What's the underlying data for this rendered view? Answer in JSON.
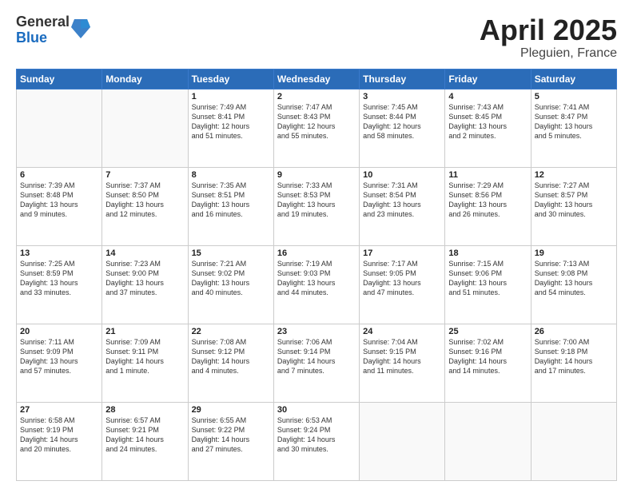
{
  "header": {
    "logo_general": "General",
    "logo_blue": "Blue",
    "month": "April 2025",
    "location": "Pleguien, France"
  },
  "weekdays": [
    "Sunday",
    "Monday",
    "Tuesday",
    "Wednesday",
    "Thursday",
    "Friday",
    "Saturday"
  ],
  "weeks": [
    [
      {
        "day": "",
        "info": ""
      },
      {
        "day": "",
        "info": ""
      },
      {
        "day": "1",
        "info": "Sunrise: 7:49 AM\nSunset: 8:41 PM\nDaylight: 12 hours\nand 51 minutes."
      },
      {
        "day": "2",
        "info": "Sunrise: 7:47 AM\nSunset: 8:43 PM\nDaylight: 12 hours\nand 55 minutes."
      },
      {
        "day": "3",
        "info": "Sunrise: 7:45 AM\nSunset: 8:44 PM\nDaylight: 12 hours\nand 58 minutes."
      },
      {
        "day": "4",
        "info": "Sunrise: 7:43 AM\nSunset: 8:45 PM\nDaylight: 13 hours\nand 2 minutes."
      },
      {
        "day": "5",
        "info": "Sunrise: 7:41 AM\nSunset: 8:47 PM\nDaylight: 13 hours\nand 5 minutes."
      }
    ],
    [
      {
        "day": "6",
        "info": "Sunrise: 7:39 AM\nSunset: 8:48 PM\nDaylight: 13 hours\nand 9 minutes."
      },
      {
        "day": "7",
        "info": "Sunrise: 7:37 AM\nSunset: 8:50 PM\nDaylight: 13 hours\nand 12 minutes."
      },
      {
        "day": "8",
        "info": "Sunrise: 7:35 AM\nSunset: 8:51 PM\nDaylight: 13 hours\nand 16 minutes."
      },
      {
        "day": "9",
        "info": "Sunrise: 7:33 AM\nSunset: 8:53 PM\nDaylight: 13 hours\nand 19 minutes."
      },
      {
        "day": "10",
        "info": "Sunrise: 7:31 AM\nSunset: 8:54 PM\nDaylight: 13 hours\nand 23 minutes."
      },
      {
        "day": "11",
        "info": "Sunrise: 7:29 AM\nSunset: 8:56 PM\nDaylight: 13 hours\nand 26 minutes."
      },
      {
        "day": "12",
        "info": "Sunrise: 7:27 AM\nSunset: 8:57 PM\nDaylight: 13 hours\nand 30 minutes."
      }
    ],
    [
      {
        "day": "13",
        "info": "Sunrise: 7:25 AM\nSunset: 8:59 PM\nDaylight: 13 hours\nand 33 minutes."
      },
      {
        "day": "14",
        "info": "Sunrise: 7:23 AM\nSunset: 9:00 PM\nDaylight: 13 hours\nand 37 minutes."
      },
      {
        "day": "15",
        "info": "Sunrise: 7:21 AM\nSunset: 9:02 PM\nDaylight: 13 hours\nand 40 minutes."
      },
      {
        "day": "16",
        "info": "Sunrise: 7:19 AM\nSunset: 9:03 PM\nDaylight: 13 hours\nand 44 minutes."
      },
      {
        "day": "17",
        "info": "Sunrise: 7:17 AM\nSunset: 9:05 PM\nDaylight: 13 hours\nand 47 minutes."
      },
      {
        "day": "18",
        "info": "Sunrise: 7:15 AM\nSunset: 9:06 PM\nDaylight: 13 hours\nand 51 minutes."
      },
      {
        "day": "19",
        "info": "Sunrise: 7:13 AM\nSunset: 9:08 PM\nDaylight: 13 hours\nand 54 minutes."
      }
    ],
    [
      {
        "day": "20",
        "info": "Sunrise: 7:11 AM\nSunset: 9:09 PM\nDaylight: 13 hours\nand 57 minutes."
      },
      {
        "day": "21",
        "info": "Sunrise: 7:09 AM\nSunset: 9:11 PM\nDaylight: 14 hours\nand 1 minute."
      },
      {
        "day": "22",
        "info": "Sunrise: 7:08 AM\nSunset: 9:12 PM\nDaylight: 14 hours\nand 4 minutes."
      },
      {
        "day": "23",
        "info": "Sunrise: 7:06 AM\nSunset: 9:14 PM\nDaylight: 14 hours\nand 7 minutes."
      },
      {
        "day": "24",
        "info": "Sunrise: 7:04 AM\nSunset: 9:15 PM\nDaylight: 14 hours\nand 11 minutes."
      },
      {
        "day": "25",
        "info": "Sunrise: 7:02 AM\nSunset: 9:16 PM\nDaylight: 14 hours\nand 14 minutes."
      },
      {
        "day": "26",
        "info": "Sunrise: 7:00 AM\nSunset: 9:18 PM\nDaylight: 14 hours\nand 17 minutes."
      }
    ],
    [
      {
        "day": "27",
        "info": "Sunrise: 6:58 AM\nSunset: 9:19 PM\nDaylight: 14 hours\nand 20 minutes."
      },
      {
        "day": "28",
        "info": "Sunrise: 6:57 AM\nSunset: 9:21 PM\nDaylight: 14 hours\nand 24 minutes."
      },
      {
        "day": "29",
        "info": "Sunrise: 6:55 AM\nSunset: 9:22 PM\nDaylight: 14 hours\nand 27 minutes."
      },
      {
        "day": "30",
        "info": "Sunrise: 6:53 AM\nSunset: 9:24 PM\nDaylight: 14 hours\nand 30 minutes."
      },
      {
        "day": "",
        "info": ""
      },
      {
        "day": "",
        "info": ""
      },
      {
        "day": "",
        "info": ""
      }
    ]
  ]
}
